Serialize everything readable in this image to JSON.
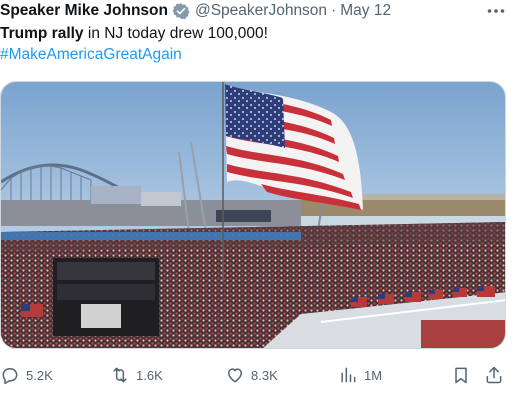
{
  "tweet": {
    "author_name": "Speaker Mike Johnson",
    "handle": "@SpeakerJohnson",
    "separator": "·",
    "date": "May 12",
    "text_bold": "Trump rally",
    "text_rest": " in NJ today drew 100,000!",
    "hashtag": "#MakeAmericaGreatAgain"
  },
  "actions": {
    "replies": "5.2K",
    "reposts": "1.6K",
    "likes": "8.3K",
    "views": "1M"
  },
  "icons": {
    "verified": "verified-badge-icon",
    "more": "more-icon",
    "reply": "reply-icon",
    "repost": "repost-icon",
    "like": "heart-icon",
    "views": "views-icon",
    "bookmark": "bookmark-icon",
    "share": "share-icon"
  },
  "colors": {
    "text": "#0f1419",
    "secondary": "#536471",
    "link": "#1d9bf0",
    "verified": "#829aab"
  }
}
